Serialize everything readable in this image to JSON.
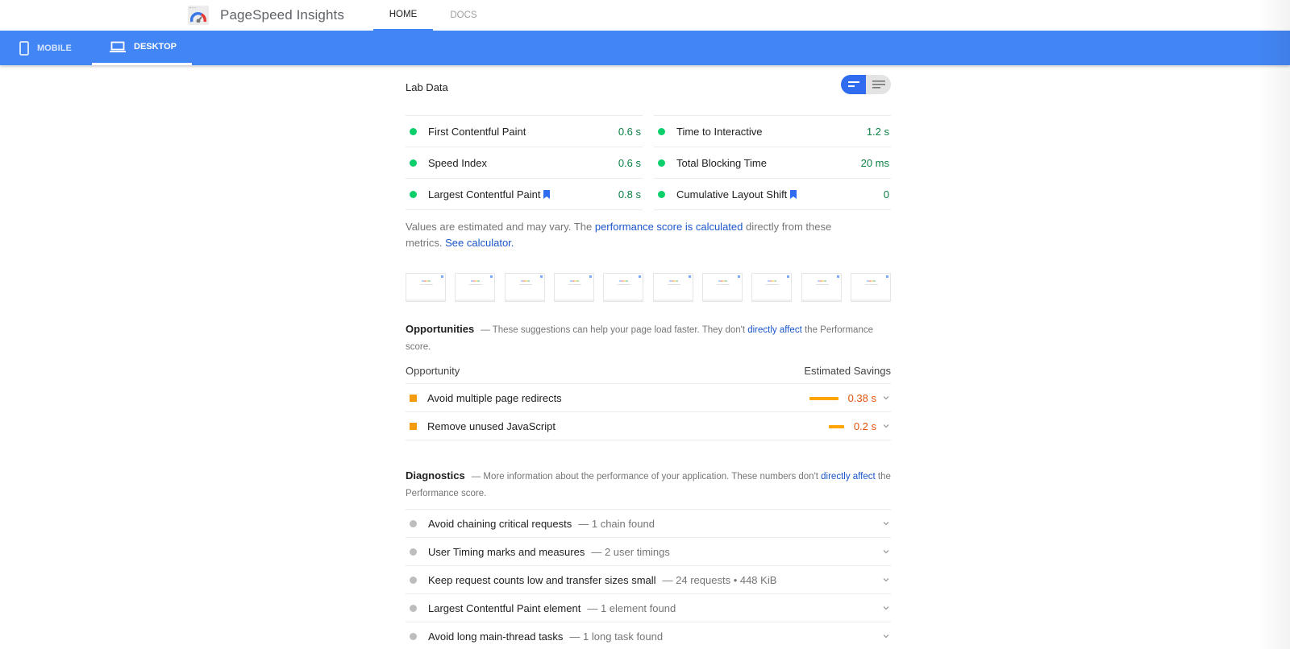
{
  "header": {
    "brand": "PageSpeed Insights",
    "nav": [
      {
        "label": "HOME",
        "active": true
      },
      {
        "label": "DOCS",
        "active": false
      }
    ]
  },
  "device_tabs": [
    {
      "label": "MOBILE",
      "icon": "phone-icon",
      "active": false
    },
    {
      "label": "DESKTOP",
      "icon": "laptop-icon",
      "active": true
    }
  ],
  "lab": {
    "title": "Lab Data",
    "view_toggle": {
      "options": [
        "bar-view-icon",
        "list-view-icon"
      ],
      "selected": "bar-view-icon"
    },
    "metrics_left": [
      {
        "label": "First Contentful Paint",
        "value": "0.6 s",
        "status": "pass",
        "badge": false
      },
      {
        "label": "Speed Index",
        "value": "0.6 s",
        "status": "pass",
        "badge": false
      },
      {
        "label": "Largest Contentful Paint",
        "value": "0.8 s",
        "status": "pass",
        "badge": true
      }
    ],
    "metrics_right": [
      {
        "label": "Time to Interactive",
        "value": "1.2 s",
        "status": "pass",
        "badge": false
      },
      {
        "label": "Total Blocking Time",
        "value": "20 ms",
        "status": "pass",
        "badge": false
      },
      {
        "label": "Cumulative Layout Shift",
        "value": "0",
        "status": "pass",
        "badge": true
      }
    ],
    "note": {
      "prefix": "Values are estimated and may vary. The ",
      "link1": "performance score is calculated",
      "middle": " directly from these metrics. ",
      "link2": "See calculator."
    },
    "filmstrip_frames": 10
  },
  "opportunities": {
    "title": "Opportunities",
    "desc_prefix": "— These suggestions can help your page load faster. They don't ",
    "desc_link": "directly affect",
    "desc_suffix": " the Performance score.",
    "col_left": "Opportunity",
    "col_right": "Estimated Savings",
    "items": [
      {
        "label": "Avoid multiple page redirects",
        "value": "0.38 s",
        "savings_seconds": 0.38
      },
      {
        "label": "Remove unused JavaScript",
        "value": "0.2 s",
        "savings_seconds": 0.2
      }
    ]
  },
  "diagnostics": {
    "title": "Diagnostics",
    "desc_prefix": "— More information about the performance of your application. These numbers don't ",
    "desc_link": "directly affect",
    "desc_suffix": " the Performance score.",
    "items": [
      {
        "label": "Avoid chaining critical requests",
        "detail": "— 1 chain found"
      },
      {
        "label": "User Timing marks and measures",
        "detail": "— 2 user timings"
      },
      {
        "label": "Keep request counts low and transfer sizes small",
        "detail": "— 24 requests • 448 KiB"
      },
      {
        "label": "Largest Contentful Paint element",
        "detail": "— 1 element found"
      },
      {
        "label": "Avoid long main-thread tasks",
        "detail": "— 1 long task found"
      }
    ]
  },
  "colors": {
    "brand_blue": "#4285f4",
    "pass_green": "#0cce6b",
    "pass_text": "#0b8043",
    "average_orange": "#ffa400",
    "savings_text": "#e2520a",
    "link_blue": "#1a55c9",
    "neutral_gray": "#bdbdbd"
  }
}
